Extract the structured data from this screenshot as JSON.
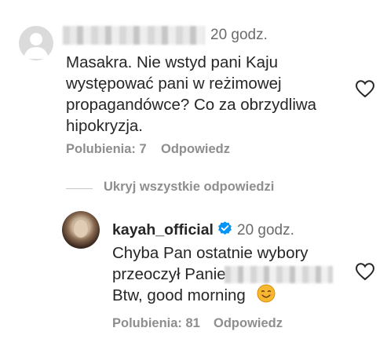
{
  "comments": [
    {
      "time": "20 godz.",
      "text": "Masakra. Nie wstyd pani Kaju\nwystępować pani w reżimowej\npropagandówce? Co za obrzydliwa\nhipokryzja.",
      "likes_label": "Polubienia: 7",
      "reply_label": "Odpowiedz"
    }
  ],
  "replies_toggle": "Ukryj wszystkie odpowiedzi",
  "reply": {
    "username": "kayah_official",
    "time": "20 godz.",
    "line1": "Chyba Pan ostatnie wybory",
    "line2": "przeoczył Panie",
    "line3": "Btw, good morning",
    "likes_label": "Polubienia: 81",
    "reply_label": "Odpowiedz"
  },
  "colors": {
    "verified": "#0095f6",
    "meta_text": "#8e8e8e"
  }
}
